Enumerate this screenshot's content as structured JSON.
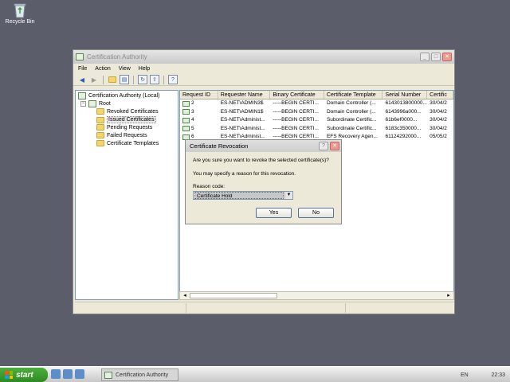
{
  "desktop": {
    "recycle_bin_label": "Recycle Bin"
  },
  "window": {
    "title": "Certification Authority",
    "menu": [
      "File",
      "Action",
      "View",
      "Help"
    ],
    "tree": {
      "root_label": "Certification Authority (Local)",
      "ca_label": "Root",
      "folders": [
        "Revoked Certificates",
        "Issued Certificates",
        "Pending Requests",
        "Failed Requests",
        "Certificate Templates"
      ],
      "selected": "Issued Certificates"
    },
    "list": {
      "columns": [
        "Request ID",
        "Requester Name",
        "Binary Certificate",
        "Certificate Template",
        "Serial Number",
        "Certific"
      ],
      "rows": [
        [
          "2",
          "ES-NET\\ADMIN3$",
          "-----BEGIN CERTI...",
          "Domain Controller (...",
          "6143013800000...",
          "30/04/2"
        ],
        [
          "3",
          "ES-NET\\ADMIN1$",
          "-----BEGIN CERTI...",
          "Domain Controller (...",
          "6143996a000...",
          "30/04/2"
        ],
        [
          "4",
          "ES-NET\\Administ...",
          "-----BEGIN CERTI...",
          "Subordinate Certific...",
          "61b6ef0000...",
          "30/04/2"
        ],
        [
          "5",
          "ES-NET\\Administ...",
          "-----BEGIN CERTI...",
          "Subordinate Certific...",
          "6183c350000...",
          "30/04/2"
        ],
        [
          "6",
          "ES-NET\\Administ...",
          "-----BEGIN CERTI...",
          "EFS Recovery Agen...",
          "61124292000...",
          "05/05/2"
        ]
      ]
    }
  },
  "dialog": {
    "title": "Certificate Revocation",
    "question": "Are you sure you want to revoke the selected certificate(s)?",
    "hint": "You may specify a reason for this revocation.",
    "reason_label": "Reason code:",
    "reason_value": "Certificate Hold",
    "yes_label": "Yes",
    "no_label": "No"
  },
  "taskbar": {
    "start_label": "start",
    "task_label": "Certification Authority",
    "language": "EN",
    "clock": "22:33"
  }
}
